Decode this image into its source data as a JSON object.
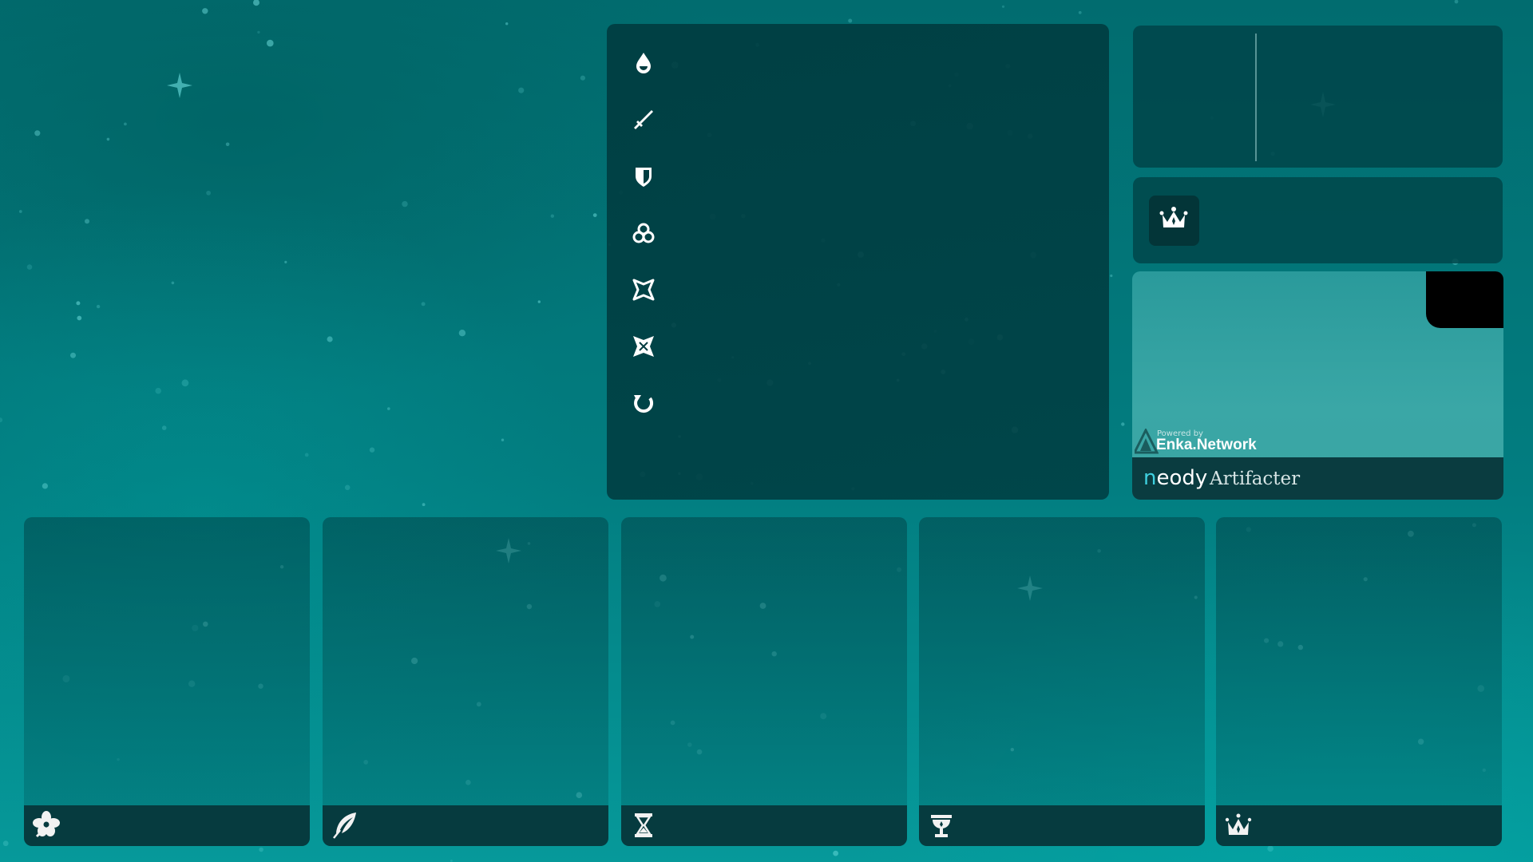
{
  "stats": {
    "icons": [
      "hp-icon",
      "atk-icon",
      "def-icon",
      "elemental-mastery-icon",
      "crit-rate-icon",
      "crit-dmg-icon",
      "energy-recharge-icon"
    ]
  },
  "set_bonus": {
    "icon": "circlet-crown-icon"
  },
  "branding": {
    "powered_by": "Powered by",
    "provider": "Enka.Network",
    "app_name_first_letter": "n",
    "app_name_rest": "eody",
    "app_suffix": "Artifacter"
  },
  "artifacts": [
    {
      "slot": "flower",
      "icon": "flower-icon"
    },
    {
      "slot": "plume",
      "icon": "feather-icon"
    },
    {
      "slot": "sands",
      "icon": "hourglass-icon"
    },
    {
      "slot": "goblet",
      "icon": "goblet-icon"
    },
    {
      "slot": "circlet",
      "icon": "crown-icon"
    }
  ],
  "colors": {
    "background": "#027d80",
    "panel": "#003c40",
    "card_bar": "#063b3f",
    "neody_accent": "#3fd1e0"
  }
}
